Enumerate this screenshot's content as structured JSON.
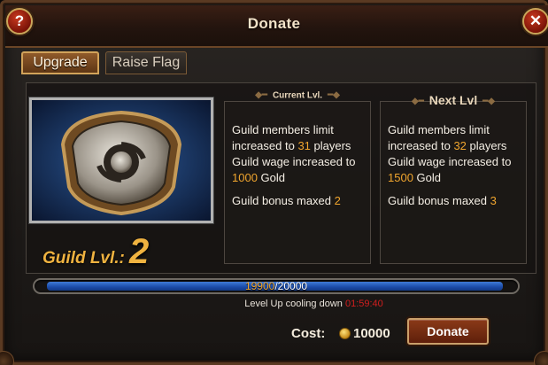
{
  "window": {
    "title": "Donate",
    "help_icon": "question-mark-icon",
    "close_icon": "close-x-icon"
  },
  "tabs": [
    {
      "label": "Upgrade",
      "active": true
    },
    {
      "label": "Raise Flag",
      "active": false
    }
  ],
  "guild": {
    "level_label": "Guild Lvl.:",
    "level_value": "2",
    "emblem_icon": "guild-shield-emblem"
  },
  "current_level": {
    "header": "Current Lvl.",
    "members_prefix": "Guild members limit increased to ",
    "members_value": "31",
    "members_suffix": " players",
    "wage_prefix": "Guild wage increased to ",
    "wage_value": "1000",
    "wage_suffix": " Gold",
    "bonus_prefix": "Guild bonus maxed ",
    "bonus_value": "2"
  },
  "next_level": {
    "header": "Next Lvl",
    "members_prefix": "Guild members limit increased to ",
    "members_value": "32",
    "members_suffix": " players",
    "wage_prefix": "Guild wage increased to ",
    "wage_value": "1500",
    "wage_suffix": " Gold",
    "bonus_prefix": "Guild bonus maxed ",
    "bonus_value": "3"
  },
  "progress": {
    "current": "19900",
    "separator": "/",
    "max": "20000",
    "fraction": 0.995
  },
  "cooldown": {
    "label": "Level Up cooling down ",
    "timer": "01:59:40"
  },
  "cost": {
    "label": "Cost:",
    "value": "10000",
    "currency_icon": "gold-coin-icon"
  },
  "donate_button": {
    "label": "Donate"
  },
  "colors": {
    "highlight": "#f0a52e",
    "guild_level": "#f0b340",
    "timer": "#d11e1e",
    "progress_bar": "#1b4ba8"
  }
}
